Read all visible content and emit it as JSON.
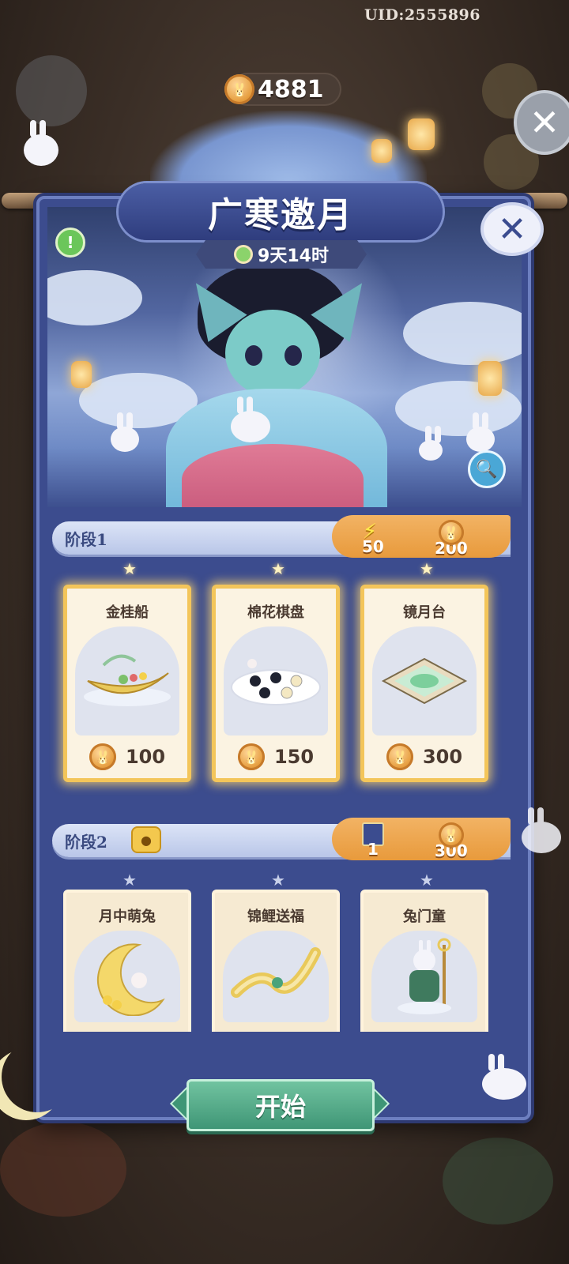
{
  "header": {
    "uid": "UID:2555896",
    "currency_value": "4881"
  },
  "panel": {
    "title": "广寒邀月",
    "timer": "9天14时"
  },
  "stage1": {
    "label": "阶段1",
    "costs": [
      {
        "icon": "lightning-bolt-icon",
        "value": "50"
      },
      {
        "icon": "mooncake-coin-icon",
        "value": "200"
      }
    ],
    "items": [
      {
        "name": "金桂船",
        "price": "100"
      },
      {
        "name": "棉花棋盘",
        "price": "150"
      },
      {
        "name": "镜月台",
        "price": "300"
      }
    ]
  },
  "stage2": {
    "label": "阶段2",
    "costs": [
      {
        "icon": "ticket-icon",
        "value": "1"
      },
      {
        "icon": "mooncake-coin-icon",
        "value": "300"
      }
    ],
    "items": [
      {
        "name": "月中萌兔"
      },
      {
        "name": "锦鲤送福"
      },
      {
        "name": "兔门童"
      }
    ]
  },
  "actions": {
    "start": "开始"
  },
  "colors": {
    "panel": "#3c4c8e",
    "accent_orange": "#e89a3c",
    "start_green": "#3f9676",
    "card_gold": "#f3c55a"
  }
}
